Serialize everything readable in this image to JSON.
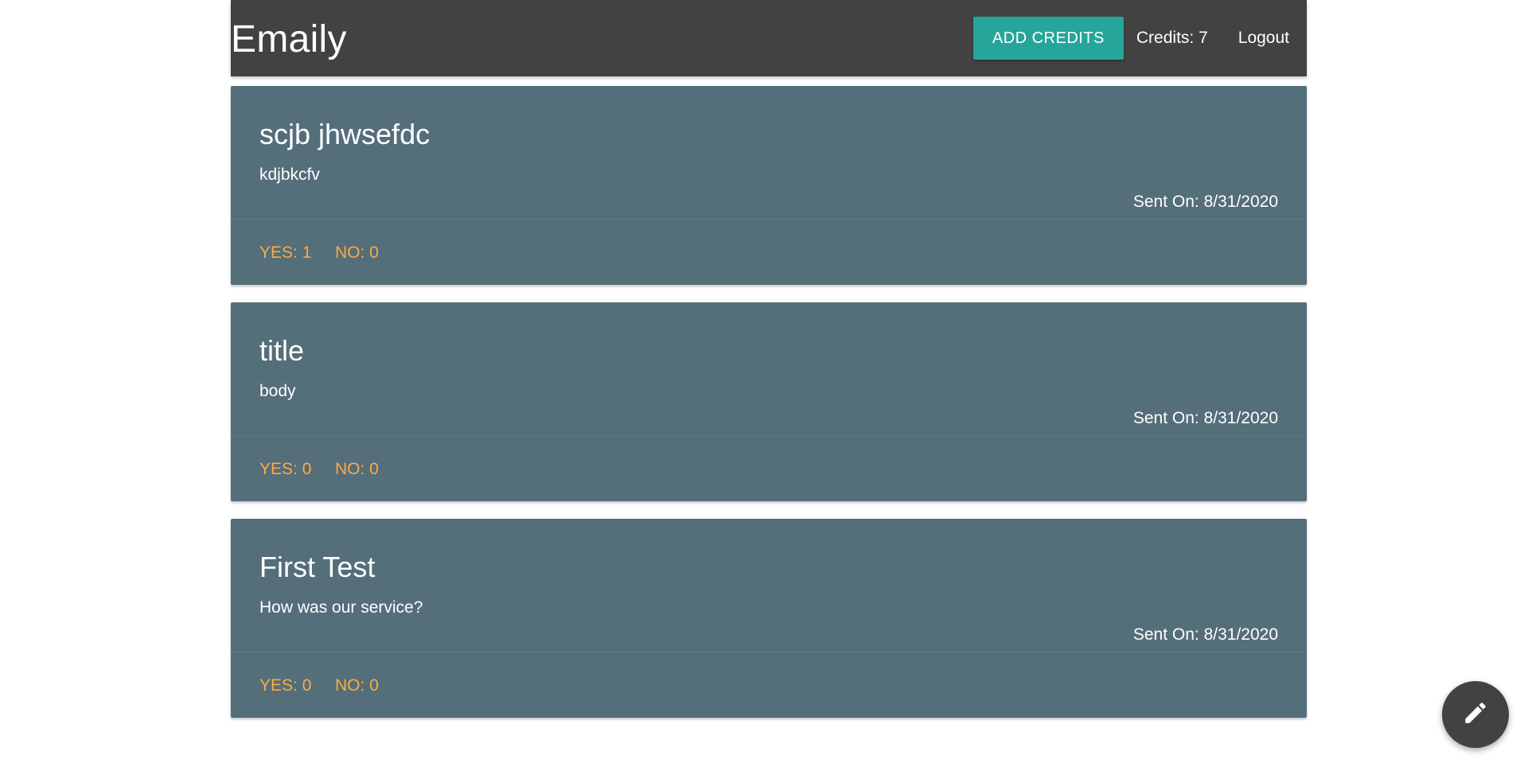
{
  "header": {
    "brand": "Emaily",
    "add_credits_label": "Add Credits",
    "credits_text": "Credits: 7",
    "logout_label": "Logout"
  },
  "surveys": [
    {
      "title": "scjb jhwsefdc",
      "body": "kdjbkcfv",
      "sent_on": "Sent On: 8/31/2020",
      "yes": "YES: 1",
      "no": "NO: 0"
    },
    {
      "title": "title",
      "body": "body",
      "sent_on": "Sent On: 8/31/2020",
      "yes": "YES: 0",
      "no": "NO: 0"
    },
    {
      "title": "First Test",
      "body": "How was our service?",
      "sent_on": "Sent On: 8/31/2020",
      "yes": "YES: 0",
      "no": "NO: 0"
    }
  ],
  "fab": {
    "icon": "pencil-icon"
  },
  "colors": {
    "navbar": "#424242",
    "accent_button": "#26a69a",
    "card": "#546e7a",
    "card_action_link": "#ffab40",
    "fab": "#424242"
  }
}
